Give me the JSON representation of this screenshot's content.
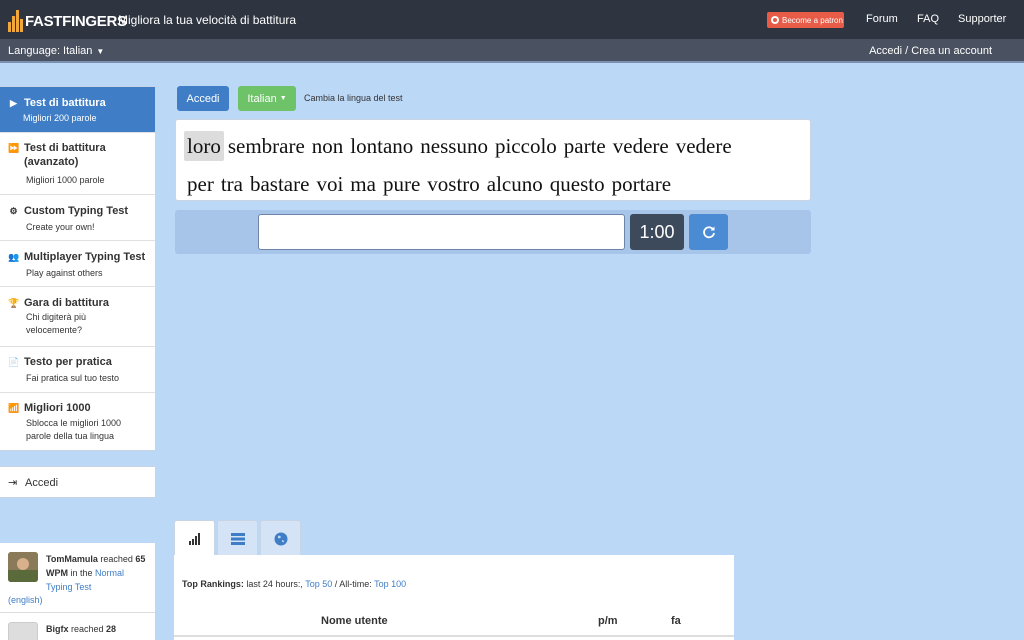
{
  "header": {
    "logo_text": "FASTFINGERS",
    "tagline": "Migliora la tua velocità di battitura",
    "patron_label": "Become a patron",
    "nav": [
      "Forum",
      "FAQ",
      "Supporter"
    ]
  },
  "subbar": {
    "language_label": "Language: Italian",
    "caret": "▼",
    "login_link": "Accedi / Crea un account"
  },
  "sidebar": {
    "items": [
      {
        "title": "Test di battitura",
        "sub": "Migliori 200 parole",
        "icon": "play-icon"
      },
      {
        "title": "Test di battitura (avanzato)",
        "sub": "Migliori 1000 parole",
        "icon": "fast-forward-icon"
      },
      {
        "title": "Custom Typing Test",
        "sub": "Create your own!",
        "icon": "gears-icon"
      },
      {
        "title": "Multiplayer Typing Test",
        "sub": "Play against others",
        "icon": "users-icon"
      },
      {
        "title": "Gara di battitura",
        "sub": "Chi digiterà più velocemente?",
        "icon": "trophy-icon"
      },
      {
        "title": "Testo per pratica",
        "sub": "Fai pratica sul tuo testo",
        "icon": "document-icon"
      },
      {
        "title": "Migliori 1000",
        "sub": "Sblocca le migliori 1000 parole della tua lingua",
        "icon": "signal-icon"
      }
    ],
    "login_label": "Accedi"
  },
  "feed": {
    "items": [
      {
        "user": "TomMamula",
        "reached": " reached ",
        "wpm": "65 WPM",
        "in_the": " in the ",
        "test": "Normal Typing Test",
        "lang": "(english)"
      },
      {
        "user": "Bigfx",
        "reached": " reached ",
        "wpm": "28"
      }
    ]
  },
  "controls": {
    "login_button": "Accedi",
    "language_button": "Italian",
    "change_language": "Cambia la lingua del test"
  },
  "test": {
    "words_line1": [
      "loro",
      "sembrare",
      "non",
      "lontano",
      "nessuno",
      "piccolo",
      "parte",
      "vedere",
      "vedere"
    ],
    "words_line2": [
      "per",
      "tra",
      "bastare",
      "voi",
      "ma",
      "pure",
      "vostro",
      "alcuno",
      "questo",
      "portare"
    ],
    "input_value": "",
    "timer": "1:00"
  },
  "rankings": {
    "label": "Top Rankings:",
    "period": " last 24 hours:, ",
    "top50": "Top 50",
    "alltime": " / All-time: ",
    "top100": "Top 100",
    "columns": [
      "Nome utente",
      "p/m",
      "fa"
    ]
  },
  "colors": {
    "background": "#bcd8f7",
    "topbar": "#2f3540",
    "accent_blue": "#3f7ec6",
    "green": "#6ec267",
    "patron": "#e85b46",
    "timer": "#3c4a5c"
  }
}
